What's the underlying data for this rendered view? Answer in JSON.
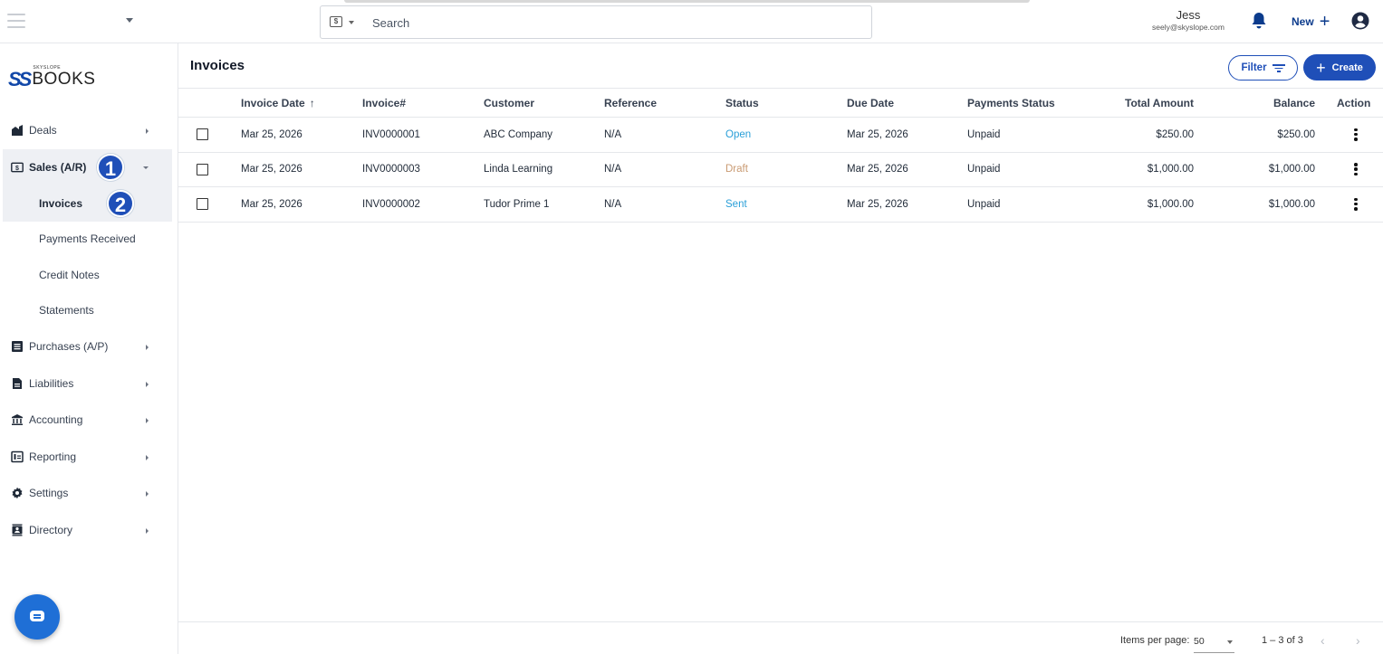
{
  "header": {
    "search_type_icon": "$",
    "search_placeholder": "Search",
    "user_name": "Jess",
    "user_email": "seely@skyslope.com",
    "new_label": "New",
    "new_plus": "+"
  },
  "logo": {
    "small": "SKYSLOPE",
    "brand": "BOOKS",
    "ss": "SS"
  },
  "sidebar": {
    "items": [
      {
        "label": "Deals",
        "icon": "deals-icon"
      },
      {
        "label": "Sales (A/R)",
        "icon": "sales-icon"
      },
      {
        "label": "Purchases (A/P)",
        "icon": "purchases-icon"
      },
      {
        "label": "Liabilities",
        "icon": "liabilities-icon"
      },
      {
        "label": "Accounting",
        "icon": "accounting-icon"
      },
      {
        "label": "Reporting",
        "icon": "reporting-icon"
      },
      {
        "label": "Settings",
        "icon": "settings-icon"
      },
      {
        "label": "Directory",
        "icon": "directory-icon"
      }
    ],
    "sales_sub": [
      {
        "label": "Invoices"
      },
      {
        "label": "Payments Received"
      },
      {
        "label": "Credit Notes"
      },
      {
        "label": "Statements"
      }
    ],
    "badges": [
      "1",
      "2"
    ]
  },
  "page": {
    "title": "Invoices",
    "filter_label": "Filter",
    "create_label": "Create",
    "create_plus": "+"
  },
  "table": {
    "columns": {
      "invoice_date": "Invoice Date",
      "sort_arrow": "↑",
      "invoice_no": "Invoice#",
      "customer": "Customer",
      "reference": "Reference",
      "status": "Status",
      "due_date": "Due Date",
      "payments_status": "Payments Status",
      "total_amount": "Total Amount",
      "balance": "Balance",
      "action": "Action"
    },
    "rows": [
      {
        "invoice_date": "Mar 25, 2026",
        "invoice_no": "INV0000001",
        "customer": "ABC Company",
        "reference": "N/A",
        "status": "Open",
        "due_date": "Mar 25, 2026",
        "payments_status": "Unpaid",
        "total_amount": "$250.00",
        "balance": "$250.00"
      },
      {
        "invoice_date": "Mar 25, 2026",
        "invoice_no": "INV0000003",
        "customer": "Linda Learning",
        "reference": "N/A",
        "status": "Draft",
        "due_date": "Mar 25, 2026",
        "payments_status": "Unpaid",
        "total_amount": "$1,000.00",
        "balance": "$1,000.00"
      },
      {
        "invoice_date": "Mar 25, 2026",
        "invoice_no": "INV0000002",
        "customer": "Tudor Prime 1",
        "reference": "N/A",
        "status": "Sent",
        "due_date": "Mar 25, 2026",
        "payments_status": "Unpaid",
        "total_amount": "$1,000.00",
        "balance": "$1,000.00"
      }
    ]
  },
  "status_colors": {
    "Open": "#2a9fd8",
    "Draft": "#c99a72",
    "Sent": "#2a9fd8"
  },
  "colors": {
    "accent": "#1f4fb8",
    "brand": "#1147a8",
    "chat": "#1f6fd6"
  },
  "footer": {
    "items_per_page_label": "Items per page:",
    "items_per_page_value": "50",
    "range": "1 – 3 of 3",
    "prev": "‹",
    "next": "›"
  }
}
